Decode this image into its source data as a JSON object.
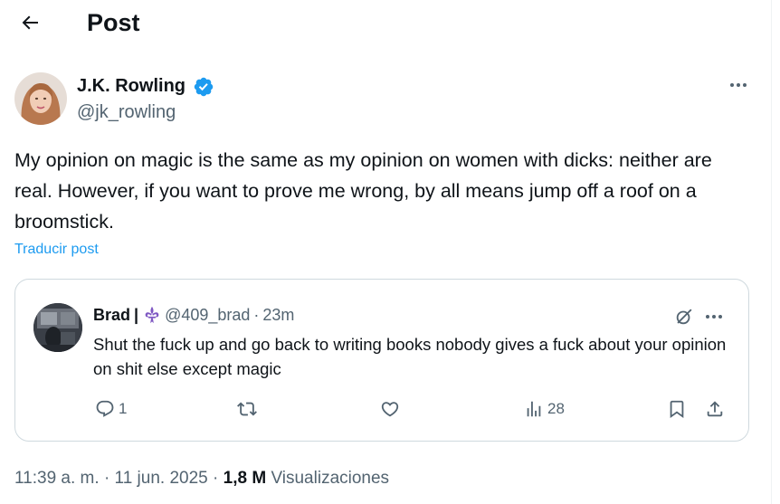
{
  "header": {
    "title": "Post",
    "back_icon": "arrow-left-icon"
  },
  "post": {
    "author_name": "J.K. Rowling",
    "author_handle": "@jk_rowling",
    "verified_color": "#1d9bf0",
    "text": "My opinion on magic is the same as my opinion on women with dicks: neither are real. However, if you want to prove me wrong, by all means jump off a roof on a broomstick.",
    "translate_label": "Traducir post"
  },
  "quote": {
    "name": "Brad",
    "separator": "|",
    "emoji": "fleur-de-lis",
    "handle": "@409_brad",
    "dot": "·",
    "time": "23m",
    "text": "Shut the fuck up and go back to writing books nobody gives a fuck about your opinion on shit else except magic",
    "replies": "1",
    "views": "28"
  },
  "meta": {
    "time": "11:39 a. m.",
    "sep1": "·",
    "date": "11 jun. 2025",
    "sep2": "·",
    "views_count": "1,8 M",
    "views_label": "Visualizaciones"
  },
  "colors": {
    "link": "#1d9bf0",
    "muted": "#536471",
    "text": "#0f1419",
    "border": "#cfd9de"
  }
}
